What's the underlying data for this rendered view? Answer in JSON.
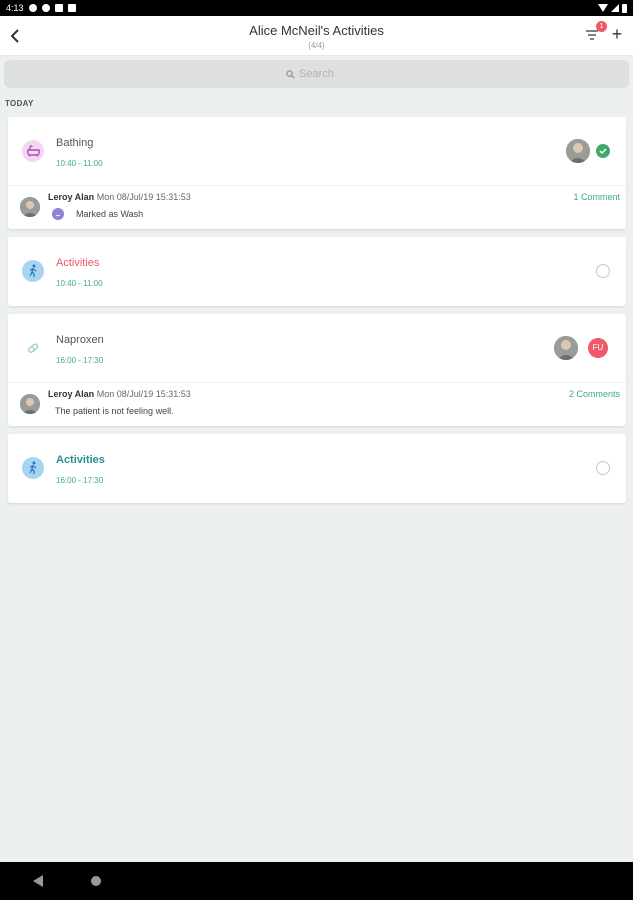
{
  "status_bar": {
    "time": "4:13",
    "icons": [
      "settings-icon",
      "location-icon",
      "sim-icon",
      "storage-icon",
      "wifi-icon",
      "signal-icon",
      "battery-icon"
    ]
  },
  "header": {
    "title": "Alice McNeil's Activities",
    "subtitle": "(4/4)",
    "filter_badge": "1",
    "add_label": "+"
  },
  "search": {
    "placeholder": "Search"
  },
  "section": {
    "label": "TODAY"
  },
  "activities": [
    {
      "title": "Bathing",
      "time": "10:40 - 11:00",
      "icon": "bathtub-icon",
      "title_color": "#555555",
      "status": "completed",
      "comment": {
        "author": "Leroy Alan",
        "date": "Mon 08/Jul/19 15:31:53",
        "text": "Marked as Wash",
        "count": "1 Comment"
      }
    },
    {
      "title": "Activities",
      "time": "10:40 - 11:00",
      "icon": "walking-icon",
      "title_color": "#ee5a68",
      "status": "pending"
    },
    {
      "title": "Naproxen",
      "time": "16:00 - 17:30",
      "icon": "pill-icon",
      "title_color": "#555555",
      "status": "follow-up",
      "badge": "FU",
      "comment": {
        "author": "Leroy Alan",
        "date": "Mon 08/Jul/19 15:31:53",
        "text": "The patient is not feeling well.",
        "count": "2 Comments"
      }
    },
    {
      "title": "Activities",
      "time": "16:00 - 17:30",
      "icon": "walking-icon",
      "title_color": "#2a8f8f",
      "status": "pending"
    }
  ],
  "colors": {
    "accent_green": "#3eaa8a",
    "badge_red": "#ee5a68",
    "check_green": "#3eaa6b",
    "background": "#edf0f0"
  }
}
